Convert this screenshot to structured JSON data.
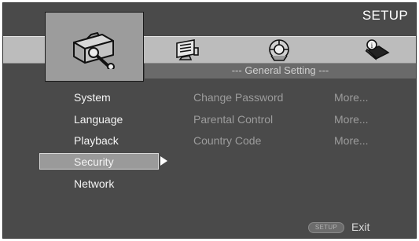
{
  "header": {
    "title": "SETUP"
  },
  "tabs": [
    {
      "icon": "toolbox-wrench-icon",
      "selected": true
    },
    {
      "icon": "display-settings-icon",
      "selected": false
    },
    {
      "icon": "speaker-audio-icon",
      "selected": false
    },
    {
      "icon": "info-book-icon",
      "selected": false
    }
  ],
  "section": {
    "title": "--- General Setting ---"
  },
  "menu": {
    "items": [
      "System",
      "Language",
      "Playback",
      "Security",
      "Network"
    ],
    "selected_index": 3
  },
  "options": [
    {
      "label": "Change Password",
      "value": "More..."
    },
    {
      "label": "Parental Control",
      "value": "More..."
    },
    {
      "label": "Country Code",
      "value": "More..."
    }
  ],
  "footer": {
    "setup_key": "SETUP",
    "exit_label": "Exit"
  },
  "colors": {
    "background": "#4a4a4a",
    "icon_bar": "#bcbcbc",
    "highlight": "#9a9a9a",
    "text": "#f4f4f4",
    "disabled_text": "#9c9c9c"
  }
}
